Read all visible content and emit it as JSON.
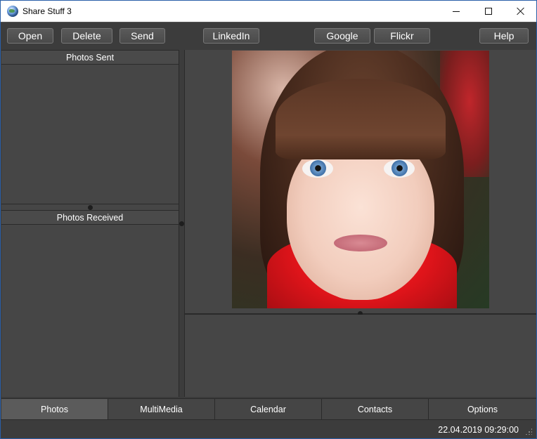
{
  "window": {
    "title": "Share Stuff 3"
  },
  "toolbar": {
    "open_label": "Open",
    "delete_label": "Delete",
    "send_label": "Send",
    "linkedin_label": "LinkedIn",
    "google_label": "Google",
    "flickr_label": "Flickr",
    "help_label": "Help"
  },
  "panels": {
    "sent_title": "Photos Sent",
    "received_title": "Photos Received"
  },
  "tabs": [
    {
      "label": "Photos",
      "active": true
    },
    {
      "label": "MultiMedia",
      "active": false
    },
    {
      "label": "Calendar",
      "active": false
    },
    {
      "label": "Contacts",
      "active": false
    },
    {
      "label": "Options",
      "active": false
    }
  ],
  "status": {
    "datetime": "22.04.2019 09:29:00"
  },
  "colors": {
    "background": "#3c3c3c",
    "panel": "#464646",
    "active_tab": "#5b5b5b",
    "text": "#ffffff"
  }
}
